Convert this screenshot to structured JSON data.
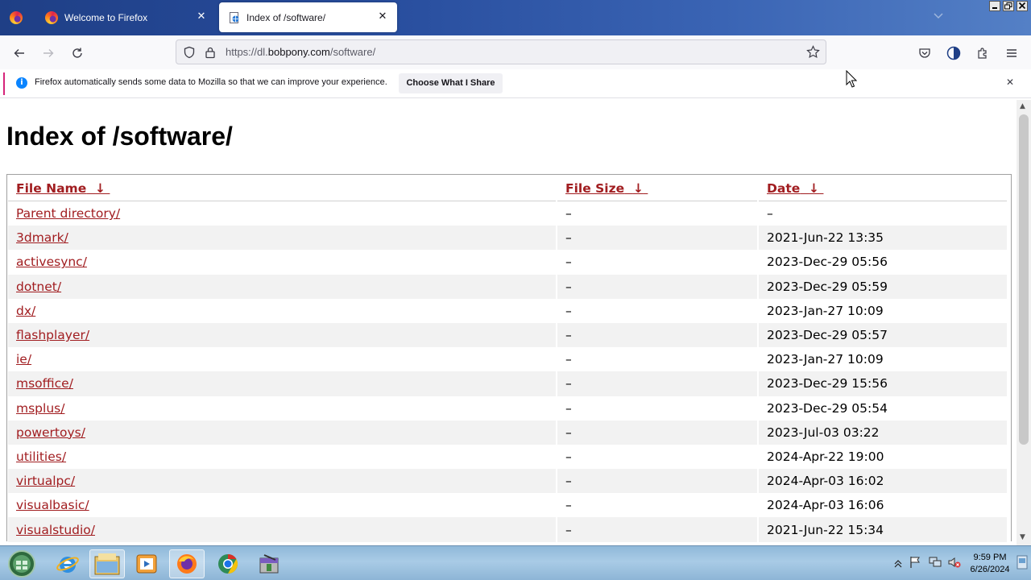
{
  "tabs": [
    {
      "label": "Welcome to Firefox",
      "close": "✕"
    },
    {
      "label": "Index of /software/",
      "close": "✕"
    }
  ],
  "urlbar": {
    "prefix": "https://dl.",
    "host": "bobpony.com",
    "path": "/software/"
  },
  "notification": {
    "message": "Firefox automatically sends some data to Mozilla so that we can improve your experience.",
    "button_label": "Choose What I Share",
    "close": "✕"
  },
  "page": {
    "title": "Index of /software/",
    "columns": [
      {
        "label": "File Name",
        "sort": "↓"
      },
      {
        "label": "File Size",
        "sort": "↓"
      },
      {
        "label": "Date",
        "sort": "↓"
      }
    ],
    "rows": [
      {
        "name": "Parent directory/",
        "size": "–",
        "date": "–"
      },
      {
        "name": "3dmark/",
        "size": "–",
        "date": "2021-Jun-22 13:35"
      },
      {
        "name": "activesync/",
        "size": "–",
        "date": "2023-Dec-29 05:56"
      },
      {
        "name": "dotnet/",
        "size": "–",
        "date": "2023-Dec-29 05:59"
      },
      {
        "name": "dx/",
        "size": "–",
        "date": "2023-Jan-27 10:09"
      },
      {
        "name": "flashplayer/",
        "size": "–",
        "date": "2023-Dec-29 05:57"
      },
      {
        "name": "ie/",
        "size": "–",
        "date": "2023-Jan-27 10:09"
      },
      {
        "name": "msoffice/",
        "size": "–",
        "date": "2023-Dec-29 15:56"
      },
      {
        "name": "msplus/",
        "size": "–",
        "date": "2023-Dec-29 05:54"
      },
      {
        "name": "powertoys/",
        "size": "–",
        "date": "2023-Jul-03 03:22"
      },
      {
        "name": "utilities/",
        "size": "–",
        "date": "2024-Apr-22 19:00"
      },
      {
        "name": "virtualpc/",
        "size": "–",
        "date": "2024-Apr-03 16:02"
      },
      {
        "name": "visualbasic/",
        "size": "–",
        "date": "2024-Apr-03 16:06"
      },
      {
        "name": "visualstudio/",
        "size": "–",
        "date": "2021-Jun-22 15:34"
      }
    ]
  },
  "taskbar": {
    "time": "9:59 PM",
    "date": "6/26/2024",
    "apps": [
      "start-orb-icon",
      "internet-explorer-icon",
      "file-explorer-icon",
      "media-player-icon",
      "firefox-icon",
      "chrome-icon",
      "archive-tool-icon"
    ]
  },
  "colors": {
    "link": "#a11d20",
    "titlebar": "#274c9c",
    "accent": "#0a84ff"
  }
}
